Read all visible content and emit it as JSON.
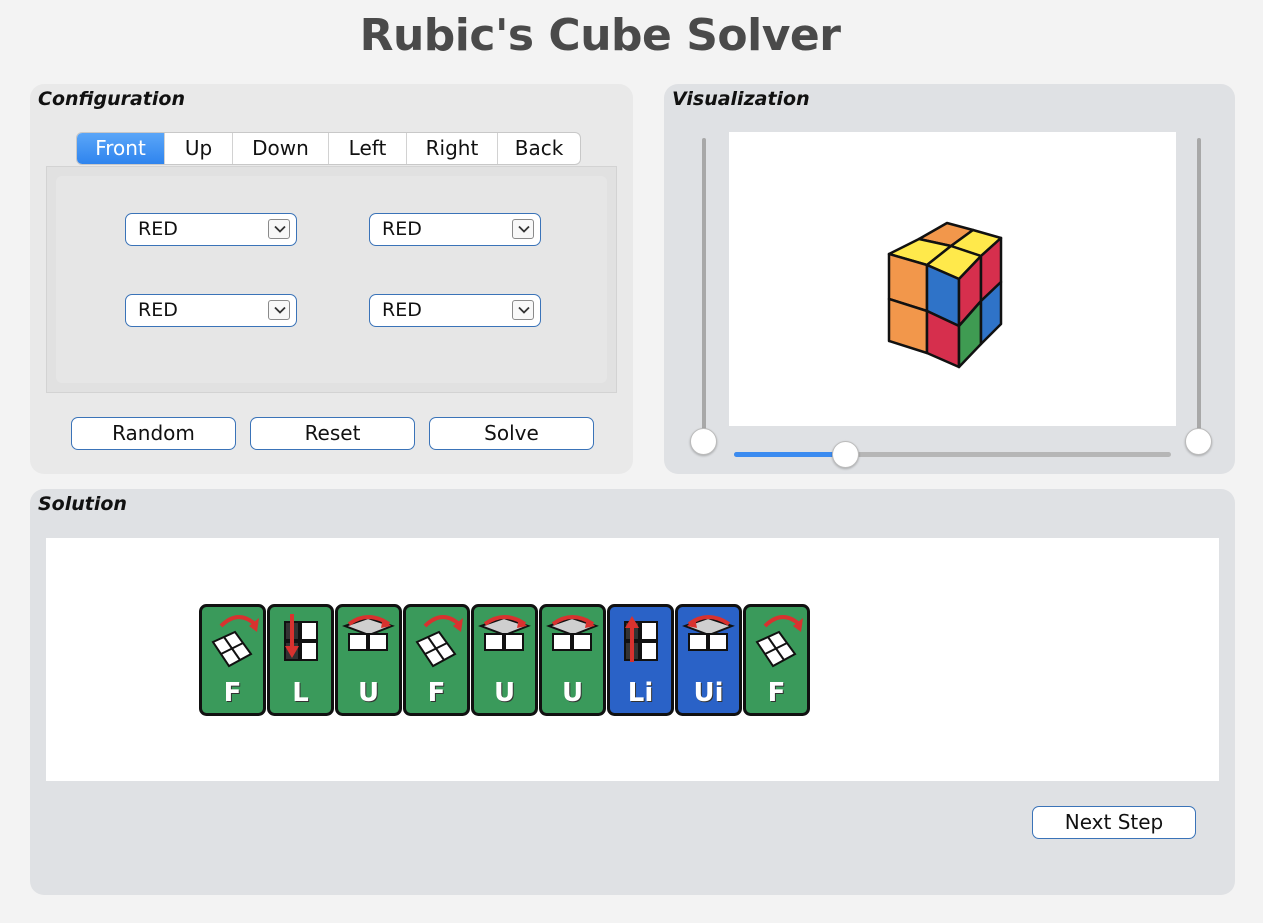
{
  "app_title": "Rubic's Cube Solver",
  "configuration": {
    "title": "Configuration",
    "tabs": [
      "Front",
      "Up",
      "Down",
      "Left",
      "Right",
      "Back"
    ],
    "active_tab": "Front",
    "colors": [
      "RED",
      "RED",
      "RED",
      "RED"
    ],
    "buttons": {
      "random": "Random",
      "reset": "Reset",
      "solve": "Solve"
    }
  },
  "visualization": {
    "title": "Visualization",
    "horizontal_slider_value": 0.25,
    "left_slider_value": 0,
    "right_slider_value": 0
  },
  "solution": {
    "title": "Solution",
    "moves": [
      {
        "label": "F",
        "icon": "rotate-front-icon",
        "color": "#3a9a5b"
      },
      {
        "label": "L",
        "icon": "rotate-left-icon",
        "color": "#3a9a5b"
      },
      {
        "label": "U",
        "icon": "rotate-up-icon",
        "color": "#3a9a5b"
      },
      {
        "label": "F",
        "icon": "rotate-front-icon",
        "color": "#3a9a5b"
      },
      {
        "label": "U",
        "icon": "rotate-up-icon",
        "color": "#3a9a5b"
      },
      {
        "label": "U",
        "icon": "rotate-up-icon",
        "color": "#3a9a5b"
      },
      {
        "label": "Li",
        "icon": "rotate-left-inverse-icon",
        "color": "#2a62c7"
      },
      {
        "label": "Ui",
        "icon": "rotate-up-inverse-icon",
        "color": "#2a62c7"
      },
      {
        "label": "F",
        "icon": "rotate-front-icon",
        "color": "#3a9a5b"
      }
    ],
    "next_step_label": "Next Step"
  },
  "colors": {
    "accent": "#3b8bf0",
    "move_green": "#3a9a5b",
    "move_blue": "#2a62c7"
  }
}
